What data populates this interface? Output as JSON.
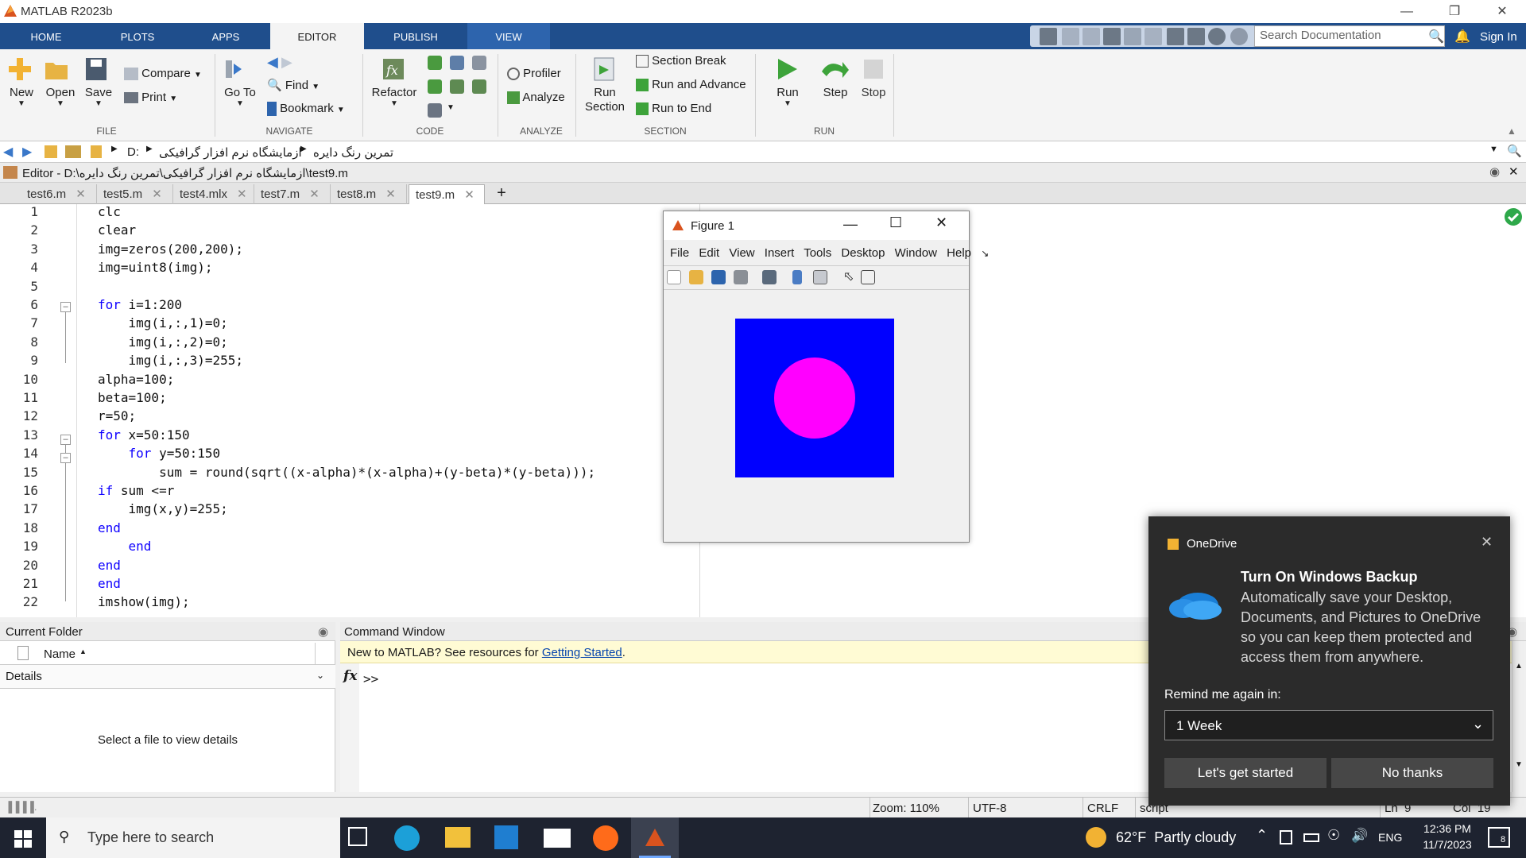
{
  "app": {
    "title": "MATLAB R2023b"
  },
  "ribbon_tabs": [
    {
      "label": "HOME"
    },
    {
      "label": "PLOTS"
    },
    {
      "label": "APPS"
    },
    {
      "label": "EDITOR",
      "active": true
    },
    {
      "label": "PUBLISH"
    },
    {
      "label": "VIEW"
    }
  ],
  "search": {
    "placeholder": "Search Documentation"
  },
  "signin": "Sign In",
  "ribbon": {
    "file": {
      "new": "New",
      "open": "Open",
      "save": "Save",
      "compare": "Compare",
      "print": "Print",
      "group": "FILE"
    },
    "navigate": {
      "goto": "Go To",
      "find": "Find",
      "bookmark": "Bookmark",
      "group": "NAVIGATE"
    },
    "code": {
      "refactor": "Refactor",
      "group": "CODE"
    },
    "analyze": {
      "profiler": "Profiler",
      "analyze": "Analyze",
      "group": "ANALYZE"
    },
    "section": {
      "run_section": "Run Section",
      "section_break": "Section Break",
      "run_advance": "Run and Advance",
      "run_end": "Run to End",
      "group": "SECTION"
    },
    "run": {
      "run": "Run",
      "step": "Step",
      "stop": "Stop",
      "group": "RUN"
    }
  },
  "address": {
    "drive": "D:",
    "folder1": "ازمایشگاه نرم افزار گرافیکی",
    "folder2": "تمرین رنگ دایره"
  },
  "editor": {
    "title": "Editor - D:\\ازمایشگاه نرم افزار گرافیکی\\تمرین رنگ دایره\\test9.m"
  },
  "file_tabs": [
    {
      "label": "test6.m"
    },
    {
      "label": "test5.m"
    },
    {
      "label": "test4.mlx"
    },
    {
      "label": "test7.m"
    },
    {
      "label": "test8.m"
    },
    {
      "label": "test9.m",
      "active": true
    }
  ],
  "add_tab": "+",
  "code_lines": [
    "clc",
    "clear",
    "img=zeros(200,200);",
    "img=uint8(img);",
    "",
    "for i=1:200",
    "    img(i,:,1)=0;",
    "    img(i,:,2)=0;",
    "    img(i,:,3)=255;",
    "alpha=100;",
    "beta=100;",
    "r=50;",
    "for x=50:150",
    "    for y=50:150",
    "        sum = round(sqrt((x-alpha)*(x-alpha)+(y-beta)*(y-beta)));",
    "if sum <=r",
    "    img(x,y)=255;",
    "end",
    "    end",
    "end",
    "end",
    "imshow(img);"
  ],
  "figure": {
    "title": "Figure 1",
    "menu": [
      "File",
      "Edit",
      "View",
      "Insert",
      "Tools",
      "Desktop",
      "Window",
      "Help"
    ],
    "square_color": "#0000ff",
    "circle_color": "#ff00ff"
  },
  "current_folder": {
    "title": "Current Folder",
    "name_col": "Name",
    "details": "Details",
    "empty_msg": "Select a file to view details"
  },
  "command_window": {
    "title": "Command Window",
    "banner_prefix": "New to MATLAB? See resources for ",
    "banner_link": "Getting Started",
    "banner_suffix": ".",
    "fx": "fx",
    "prompt": ">>"
  },
  "status": {
    "zoom": "Zoom: 110%",
    "encoding": "UTF-8",
    "eol": "CRLF",
    "type": "script",
    "ln": "Ln  9",
    "col": "Col  19"
  },
  "onedrive": {
    "app": "OneDrive",
    "heading": "Turn On Windows Backup",
    "body": "Automatically save your Desktop, Documents, and Pictures to OneDrive so you can keep them protected and access them from anywhere.",
    "remind_label": "Remind me again in:",
    "remind_value": "1 Week",
    "primary": "Let's get started",
    "secondary": "No thanks"
  },
  "taskbar": {
    "search_placeholder": "Type here to search",
    "weather": "62°F  Partly cloudy",
    "lang": "ENG",
    "time": "12:36 PM",
    "date": "11/7/2023",
    "notifications": "8"
  }
}
